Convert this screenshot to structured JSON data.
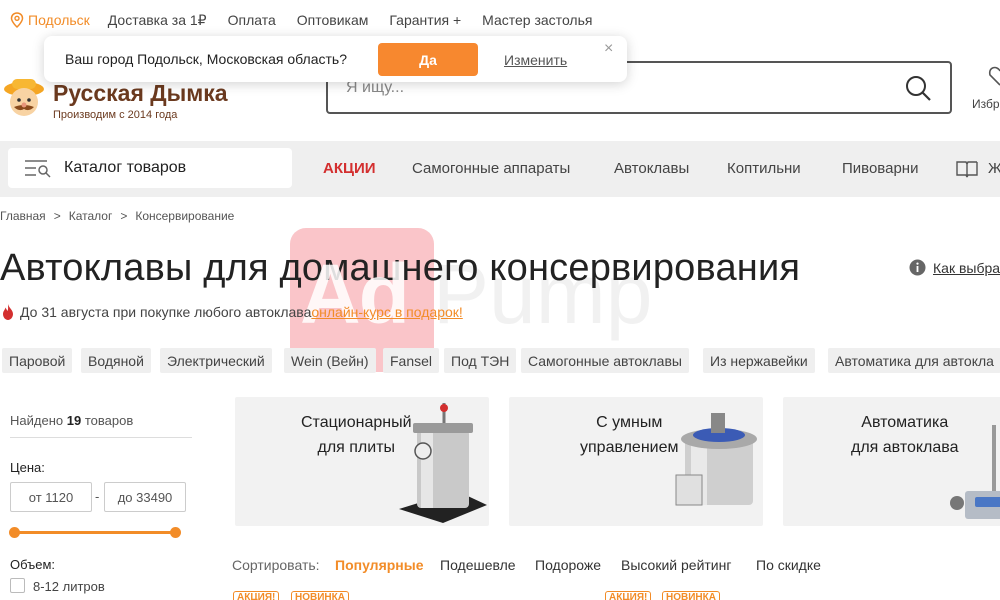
{
  "topbar": {
    "city": "Подольск",
    "links": [
      "Доставка за 1₽",
      "Оплата",
      "Оптовикам",
      "Гарантия +",
      "Мастер застолья"
    ]
  },
  "popup": {
    "question": "Ваш город Подольск, Московская область?",
    "yes": "Да",
    "change": "Изменить",
    "close": "×"
  },
  "header": {
    "brand": "Русская Дымка",
    "tagline": "Производим с 2014 года",
    "search_placeholder": "Я ищу...",
    "favorites": "Избр"
  },
  "nav": {
    "catalog": "Каталог товаров",
    "items": [
      "АКЦИИ",
      "Самогонные аппараты",
      "Автоклавы",
      "Коптильни",
      "Пивоварни",
      "Ж"
    ]
  },
  "breadcrumbs": [
    "Главная",
    "Каталог",
    "Консервирование"
  ],
  "page": {
    "title": "Автоклавы для домашнего консервирования",
    "how_link": "Как выбра",
    "promo_text": "До 31 августа при покупке любого автоклава ",
    "promo_link": "онлайн-курс в подарок!"
  },
  "tags": [
    "Паровой",
    "Водяной",
    "Электрический",
    "Wein (Вейн)",
    "Fansel",
    "Под ТЭН",
    "Самогонные автоклавы",
    "Из нержавейки",
    "Автоматика для автокла"
  ],
  "filters": {
    "found_prefix": "Найдено",
    "found_count": "19",
    "found_suffix": "товаров",
    "price_label": "Цена:",
    "price_from": "от 1120",
    "price_to": "до 33490",
    "price_dash": "-",
    "volume_label": "Объем:",
    "volume_option": "8-12 литров"
  },
  "cards": [
    {
      "title": "Стационарный\nдля плиты"
    },
    {
      "title": "С умным\nуправлением"
    },
    {
      "title": "Автоматика\nдля автоклава"
    }
  ],
  "sort": {
    "label": "Сортировать:",
    "options": [
      "Популярные",
      "Подешевле",
      "Подороже",
      "Высокий рейтинг",
      "По скидке"
    ],
    "active_index": 0
  },
  "badges": [
    "АКЦИЯ!",
    "НОВИНКА",
    "АКЦИЯ!",
    "НОВИНКА"
  ],
  "watermark": {
    "logo": "Ad",
    "rest": "Pump"
  },
  "colors": {
    "accent": "#f28c28",
    "brand": "#6b3a1f",
    "promo": "#d32f2f",
    "nav_bg": "#efefef"
  }
}
